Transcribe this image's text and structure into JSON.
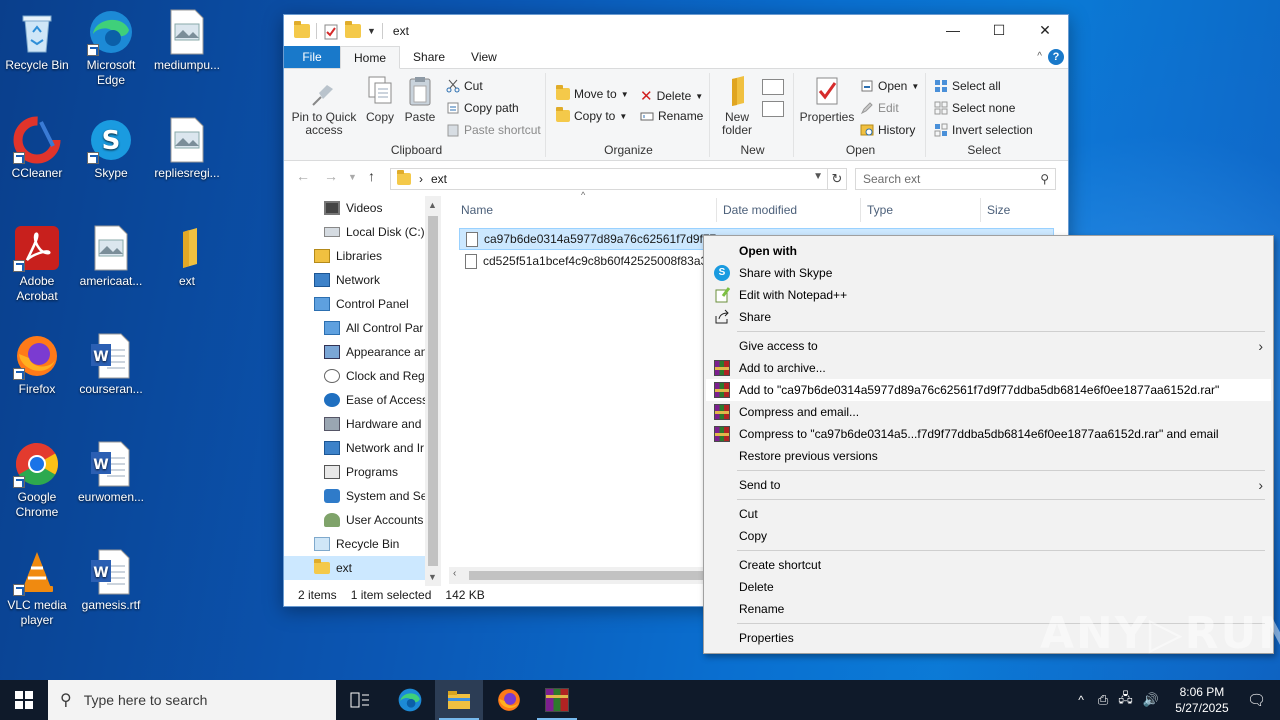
{
  "desktop": {
    "icons": [
      {
        "label": "Recycle Bin"
      },
      {
        "label": "Microsoft Edge"
      },
      {
        "label": "mediumpu..."
      },
      {
        "label": "CCleaner"
      },
      {
        "label": "Skype"
      },
      {
        "label": "repliesregi..."
      },
      {
        "label": "Adobe Acrobat"
      },
      {
        "label": "americaat..."
      },
      {
        "label": "ext"
      },
      {
        "label": "Firefox"
      },
      {
        "label": "courseran..."
      },
      {
        "label": "Google Chrome"
      },
      {
        "label": "eurwomen..."
      },
      {
        "label": "VLC media player"
      },
      {
        "label": "gamesis.rtf"
      }
    ]
  },
  "window": {
    "title": "ext",
    "tabs": {
      "file": "File",
      "home": "Home",
      "share": "Share",
      "view": "View"
    },
    "help_glyph": "?",
    "ribbon": {
      "clipboard": {
        "label": "Clipboard",
        "pin": "Pin to Quick access",
        "copy": "Copy",
        "paste": "Paste",
        "cut": "Cut",
        "copy_path": "Copy path",
        "paste_shortcut": "Paste shortcut"
      },
      "organize": {
        "label": "Organize",
        "move_to": "Move to",
        "copy_to": "Copy to",
        "delete": "Delete",
        "rename": "Rename"
      },
      "new": {
        "label": "New",
        "new_folder": "New folder"
      },
      "open": {
        "label": "Open",
        "properties": "Properties",
        "open": "Open",
        "edit": "Edit",
        "history": "History"
      },
      "select": {
        "label": "Select",
        "select_all": "Select all",
        "select_none": "Select none",
        "invert": "Invert selection"
      }
    },
    "address": {
      "path": "ext",
      "separator": "›"
    },
    "search": {
      "placeholder": "Search ext"
    },
    "nav": [
      {
        "label": "Videos"
      },
      {
        "label": "Local Disk (C:)"
      },
      {
        "label": "Libraries"
      },
      {
        "label": "Network"
      },
      {
        "label": "Control Panel"
      },
      {
        "label": "All Control Par"
      },
      {
        "label": "Appearance an"
      },
      {
        "label": "Clock and Regi"
      },
      {
        "label": "Ease of Access"
      },
      {
        "label": "Hardware and"
      },
      {
        "label": "Network and Ir"
      },
      {
        "label": "Programs"
      },
      {
        "label": "System and Sec"
      },
      {
        "label": "User Accounts"
      },
      {
        "label": "Recycle Bin"
      },
      {
        "label": "ext"
      }
    ],
    "columns": {
      "name": "Name",
      "date": "Date modified",
      "type": "Type",
      "size": "Size"
    },
    "files": [
      {
        "name": "ca97b6de0314a5977d89a76c62561f7d9f77..."
      },
      {
        "name": "cd525f51a1bcef4c9c8b60f42525008f83a30..."
      }
    ],
    "status": {
      "count": "2 items",
      "selected": "1 item selected",
      "size": "142 KB"
    }
  },
  "context_menu": {
    "items": [
      {
        "label": "Open with"
      },
      {
        "label": "Share with Skype"
      },
      {
        "label": "Edit with Notepad++"
      },
      {
        "label": "Share"
      },
      {
        "label": "Give access to"
      },
      {
        "label": "Add to archive..."
      },
      {
        "label": "Add to \"ca97b6de0314a5977d89a76c62561f7d9f77ddba5db6814e6f0ee1877aa6152d.rar\""
      },
      {
        "label": "Compress and email..."
      },
      {
        "label": "Compress to \"ca97b6de0314a5...f7d9f77ddba5db6814e6f0ee1877aa6152d.rar\" and email"
      },
      {
        "label": "Restore previous versions"
      },
      {
        "label": "Send to"
      },
      {
        "label": "Cut"
      },
      {
        "label": "Copy"
      },
      {
        "label": "Create shortcut"
      },
      {
        "label": "Delete"
      },
      {
        "label": "Rename"
      },
      {
        "label": "Properties"
      }
    ]
  },
  "taskbar": {
    "search_placeholder": "Type here to search",
    "time": "8:06 PM",
    "date": "5/27/2025"
  },
  "watermark": "ANY▷RUN",
  "colors": {
    "accent": "#1979ca",
    "selection": "#cce8ff",
    "taskbar": "#0f1a2a"
  }
}
